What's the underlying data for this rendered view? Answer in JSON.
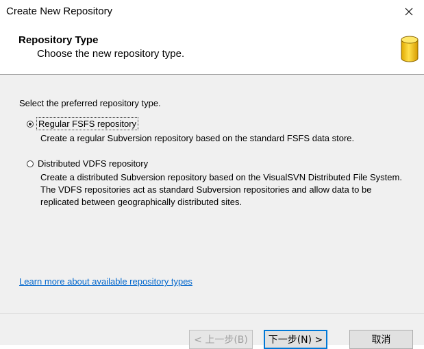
{
  "window": {
    "title": "Create New Repository"
  },
  "header": {
    "title": "Repository Type",
    "subtitle": "Choose the new repository type."
  },
  "content": {
    "prompt": "Select the preferred repository type.",
    "options": [
      {
        "label": "Regular FSFS repository",
        "description": "Create a regular Subversion repository based on the standard FSFS data store.",
        "selected": true
      },
      {
        "label": "Distributed VDFS repository",
        "description": "Create a distributed Subversion repository based on the VisualSVN Distributed File System. The VDFS repositories act as standard Subversion repositories and allow data to be replicated between geographically distributed sites.",
        "selected": false
      }
    ],
    "learn_more_link": "Learn more about available repository types"
  },
  "footer": {
    "back_label": "< 上一步(B)",
    "next_label": "下一步(N) >",
    "cancel_label": "取消"
  },
  "icons": {
    "close": "close-icon",
    "header_icon": "database-icon"
  },
  "colors": {
    "accent": "#0078d7",
    "link": "#0066cc",
    "db_gold": "#f2c200"
  }
}
